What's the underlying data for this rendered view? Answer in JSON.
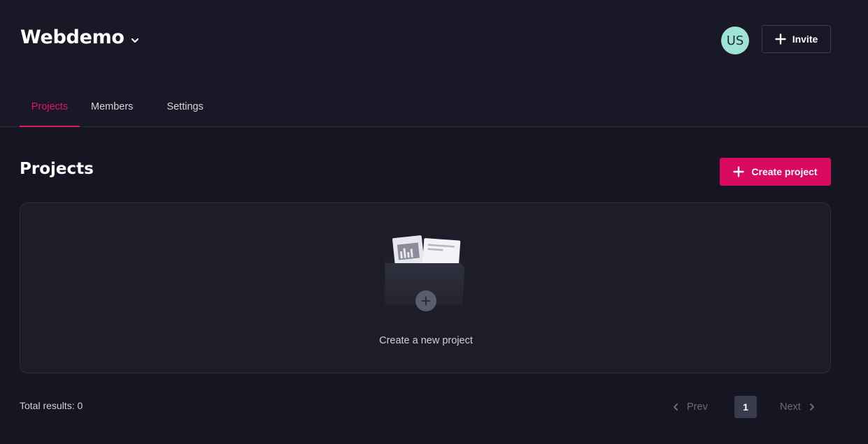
{
  "header": {
    "org_name": "Webdemo",
    "avatar_initials": "US",
    "invite_label": "Invite"
  },
  "tabs": [
    {
      "label": "Projects",
      "active": true
    },
    {
      "label": "Members",
      "active": false
    },
    {
      "label": "Settings",
      "active": false
    }
  ],
  "main": {
    "title": "Projects",
    "create_label": "Create project",
    "empty_label": "Create a new project",
    "total_label": "Total results: 0"
  },
  "pagination": {
    "prev_label": "Prev",
    "current_page": "1",
    "next_label": "Next"
  },
  "icons": {
    "org_chevron": "chevron-down-icon",
    "invite": "plus-icon",
    "create": "plus-icon",
    "empty": "folder-icon",
    "prev": "chevron-left-icon",
    "next": "chevron-right-icon"
  },
  "colors": {
    "background": "#161622",
    "accent": "#d9095f",
    "avatar": "#9fe3d6",
    "card": "#1d1d2a"
  }
}
